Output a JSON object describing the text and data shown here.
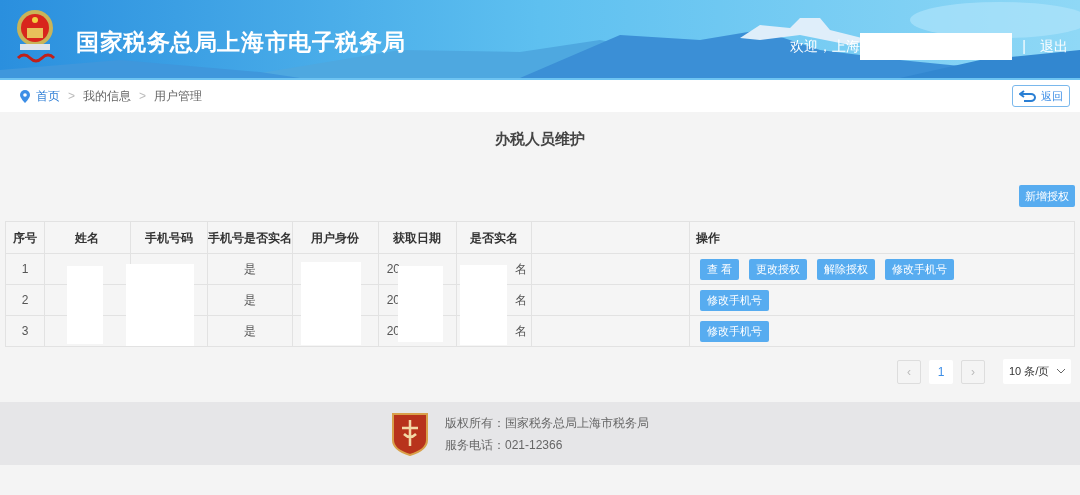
{
  "header": {
    "title": "国家税务总局上海市电子税务局",
    "welcome": "欢迎，上海",
    "separator": "|",
    "logout": "退出"
  },
  "breadcrumb": {
    "items": [
      {
        "label": "首页",
        "selected": true
      },
      {
        "label": "我的信息",
        "selected": false
      },
      {
        "label": "用户管理",
        "selected": false
      }
    ],
    "separators": [
      ">",
      ">"
    ],
    "back": "返回"
  },
  "page_title": "办税人员维护",
  "add_button": "新增授权",
  "table": {
    "columns": [
      "序号",
      "姓名",
      "手机号码",
      "手机号是否实名",
      "用户身份",
      "获取日期",
      "是否实名",
      "",
      "操作"
    ],
    "rows": [
      {
        "index": "1",
        "phone_verified": "是",
        "date": "20",
        "realname": "名",
        "actions": [
          "查 看",
          "更改授权",
          "解除授权",
          "修改手机号"
        ]
      },
      {
        "index": "2",
        "phone_verified": "是",
        "date": "20",
        "realname": "名",
        "actions": [
          "修改手机号"
        ]
      },
      {
        "index": "3",
        "phone_verified": "是",
        "date": "20",
        "realname": "名",
        "actions": [
          "修改手机号"
        ]
      }
    ]
  },
  "pagination": {
    "prev": "‹",
    "pages": [
      {
        "label": "1",
        "selected": true
      }
    ],
    "next": "›",
    "page_size": "10 条/页"
  },
  "footer": {
    "copyright": "版权所有：国家税务总局上海市税务局",
    "phone": "服务电话：021-12366"
  }
}
